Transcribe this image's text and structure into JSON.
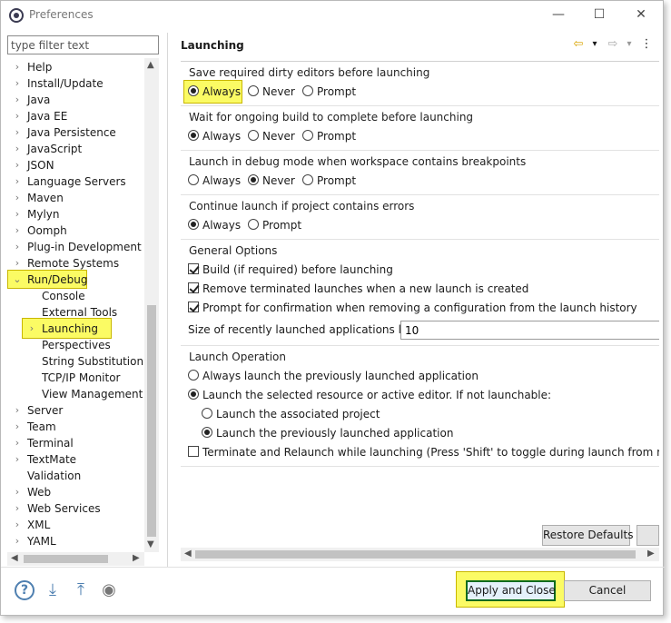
{
  "window": {
    "title": "Preferences",
    "minimize": "—",
    "maximize": "☐",
    "close": "✕"
  },
  "filter": {
    "placeholder": "type filter text"
  },
  "tree": {
    "items": [
      {
        "label": "Help",
        "expander": "›"
      },
      {
        "label": "Install/Update",
        "expander": "›"
      },
      {
        "label": "Java",
        "expander": "›"
      },
      {
        "label": "Java EE",
        "expander": "›"
      },
      {
        "label": "Java Persistence",
        "expander": "›"
      },
      {
        "label": "JavaScript",
        "expander": "›"
      },
      {
        "label": "JSON",
        "expander": "›"
      },
      {
        "label": "Language Servers",
        "expander": "›"
      },
      {
        "label": "Maven",
        "expander": "›"
      },
      {
        "label": "Mylyn",
        "expander": "›"
      },
      {
        "label": "Oomph",
        "expander": "›"
      },
      {
        "label": "Plug-in Development",
        "expander": "›"
      },
      {
        "label": "Remote Systems",
        "expander": "›"
      },
      {
        "label": "Run/Debug",
        "expander": "⌄"
      },
      {
        "label": "Console",
        "expander": ""
      },
      {
        "label": "External Tools",
        "expander": ""
      },
      {
        "label": "Launching",
        "expander": "›"
      },
      {
        "label": "Perspectives",
        "expander": ""
      },
      {
        "label": "String Substitution",
        "expander": ""
      },
      {
        "label": "TCP/IP Monitor",
        "expander": ""
      },
      {
        "label": "View Management",
        "expander": ""
      },
      {
        "label": "Server",
        "expander": "›"
      },
      {
        "label": "Team",
        "expander": "›"
      },
      {
        "label": "Terminal",
        "expander": "›"
      },
      {
        "label": "TextMate",
        "expander": "›"
      },
      {
        "label": "Validation",
        "expander": ""
      },
      {
        "label": "Web",
        "expander": "›"
      },
      {
        "label": "Web Services",
        "expander": "›"
      },
      {
        "label": "XML",
        "expander": "›"
      },
      {
        "label": "YAML",
        "expander": "›"
      }
    ]
  },
  "pane": {
    "title": "Launching",
    "back_icon": "⇦",
    "forward_icon": "⇨",
    "dropdown": "▾",
    "menu_icon": "⋮",
    "groups": {
      "dirty": {
        "label": "Save required dirty editors before launching",
        "options": [
          "Always",
          "Never",
          "Prompt"
        ],
        "selected": "Always"
      },
      "build": {
        "label": "Wait for ongoing build to complete before launching",
        "options": [
          "Always",
          "Never",
          "Prompt"
        ],
        "selected": "Always"
      },
      "debug": {
        "label": "Launch in debug mode when workspace contains breakpoints",
        "options": [
          "Always",
          "Never",
          "Prompt"
        ],
        "selected": "Never"
      },
      "errors": {
        "label": "Continue launch if project contains errors",
        "options": [
          "Always",
          "Prompt"
        ],
        "selected": "Always"
      },
      "general": {
        "label": "General Options",
        "build_label": "Build (if required) before launching",
        "remove_label": "Remove terminated launches when a new launch is created",
        "prompt_label": "Prompt for confirmation when removing a configuration from the launch history",
        "size_label": "Size of recently launched applications list:",
        "size_value": "10"
      },
      "operation": {
        "label": "Launch Operation",
        "always_prev": "Always launch the previously launched application",
        "selected_resource": "Launch the selected resource or active editor. If not launchable:",
        "assoc_project": "Launch the associated project",
        "prev_app": "Launch the previously launched application",
        "terminate": "Terminate and Relaunch while launching (Press 'Shift' to toggle during launch from menu an"
      }
    },
    "restore_defaults": "Restore Defaults"
  },
  "footer": {
    "help_icon": "?",
    "import_icon": "⤓",
    "export_icon": "⤒",
    "record_icon": "◉",
    "apply_close": "Apply and Close",
    "cancel": "Cancel"
  },
  "colors": {
    "highlight": "#fbfb64",
    "highlight_border": "#c9b700",
    "icon_blue": "#4e7fb0"
  }
}
